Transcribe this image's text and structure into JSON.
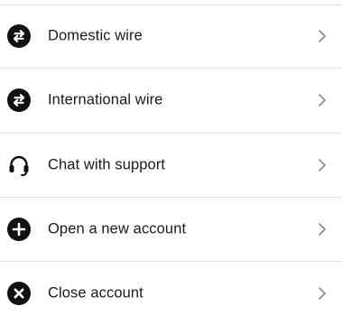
{
  "menu": {
    "items": [
      {
        "label": "Domestic wire",
        "icon": "transfer-arrows-icon"
      },
      {
        "label": "International wire",
        "icon": "transfer-arrows-icon"
      },
      {
        "label": "Chat with support",
        "icon": "headset-icon"
      },
      {
        "label": "Open a new account",
        "icon": "plus-circle-icon"
      },
      {
        "label": "Close account",
        "icon": "close-circle-icon"
      }
    ],
    "chevron_icon": "chevron-right-icon"
  },
  "colors": {
    "text": "#1b1b1b",
    "icon": "#111111",
    "divider": "#e4e4e4",
    "chevron": "#8a8a8a"
  }
}
